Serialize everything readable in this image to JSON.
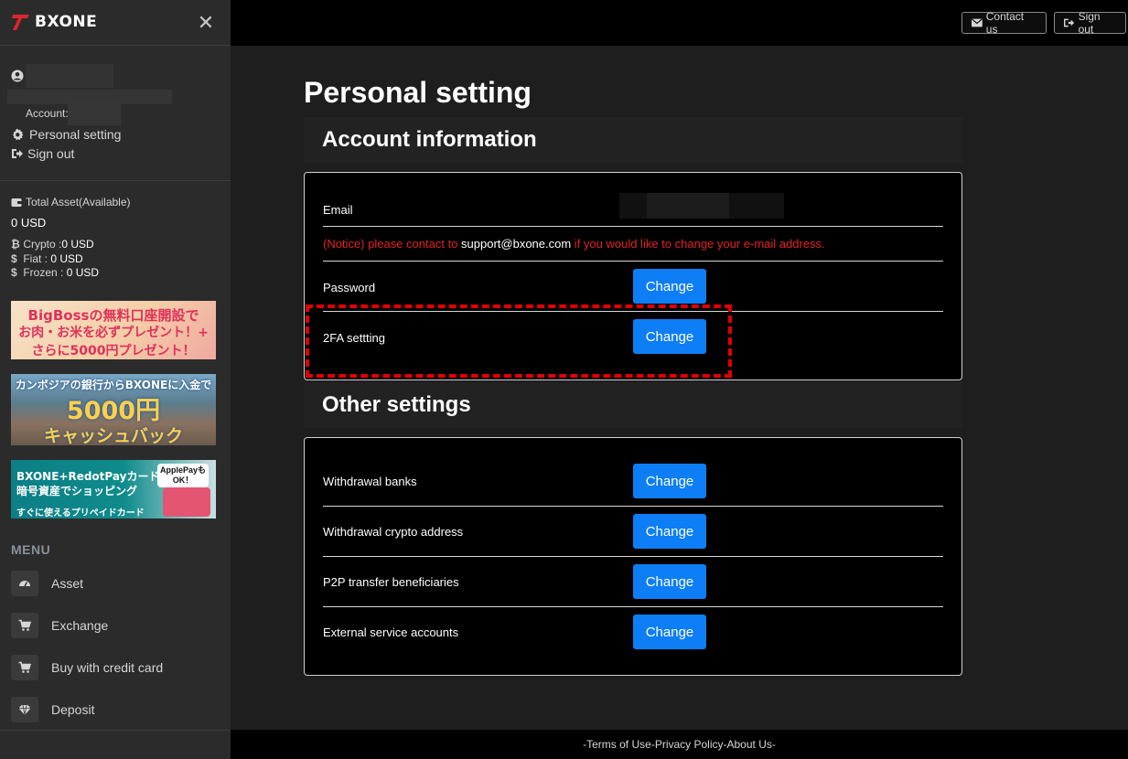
{
  "sidebar": {
    "logo_text": "BXONE",
    "account_label": "Account:",
    "personal_setting": "Personal setting",
    "sign_out": "Sign out",
    "asset_title": "Total Asset(Available)",
    "total": "0 USD",
    "crypto_label": "Crypto :",
    "crypto_value": "0 USD",
    "fiat_label": "Fiat : ",
    "fiat_value": "0 USD",
    "frozen_label": "Frozen : ",
    "frozen_value": "0 USD",
    "banners": [
      {
        "l1": "BigBossの無料口座開設で",
        "l2": "お肉・お米を必ずプレゼント！+",
        "l3": "さらに5000円プレゼント！"
      },
      {
        "l1": "カンボジアの銀行からBXONEに入金で",
        "l2": "5000円",
        "l3": "キャッシュバック"
      },
      {
        "l1": "BXONE+RedotPayカード",
        "l2": "暗号資産でショッピング",
        "l3": "すぐに使えるプリペイドカード",
        "badge": "ApplePayも OK！"
      }
    ],
    "menu_title": "MENU",
    "menu": [
      {
        "label": "Asset",
        "icon": "dashboard-icon"
      },
      {
        "label": "Exchange",
        "icon": "cart-icon"
      },
      {
        "label": "Buy with credit card",
        "icon": "cart-icon"
      },
      {
        "label": "Deposit",
        "icon": "diamond-icon"
      }
    ]
  },
  "topbar": {
    "contact_us": "Contact us",
    "sign_out": "Sign out"
  },
  "main": {
    "page_title": "Personal setting",
    "account_section": {
      "title": "Account information",
      "email_label": "Email",
      "notice_pre": "(Notice) please contact to ",
      "notice_email": "support@bxone.com",
      "notice_post": " if you would like to change your e-mail address.",
      "password_label": "Password",
      "twofa_label": "2FA settting",
      "change_label": "Change"
    },
    "other_section": {
      "title": "Other settings",
      "rows": [
        {
          "label": "Withdrawal banks",
          "button": "Change"
        },
        {
          "label": "Withdrawal crypto address",
          "button": "Change"
        },
        {
          "label": "P2P transfer beneficiaries",
          "button": "Change"
        },
        {
          "label": "External service accounts",
          "button": "Change"
        }
      ]
    }
  },
  "footer": {
    "dash1": "- ",
    "terms": "Terms of Use",
    "sep1": " - ",
    "privacy": "Privacy Policy",
    "sep2": " - ",
    "about": "About Us",
    "dash2": " -"
  },
  "colors": {
    "accent": "#0d7ef5",
    "notice": "#e42121",
    "highlight": "#e00000",
    "sidebar_bg": "#2b2b2b",
    "main_bg": "#1e1e1e"
  }
}
